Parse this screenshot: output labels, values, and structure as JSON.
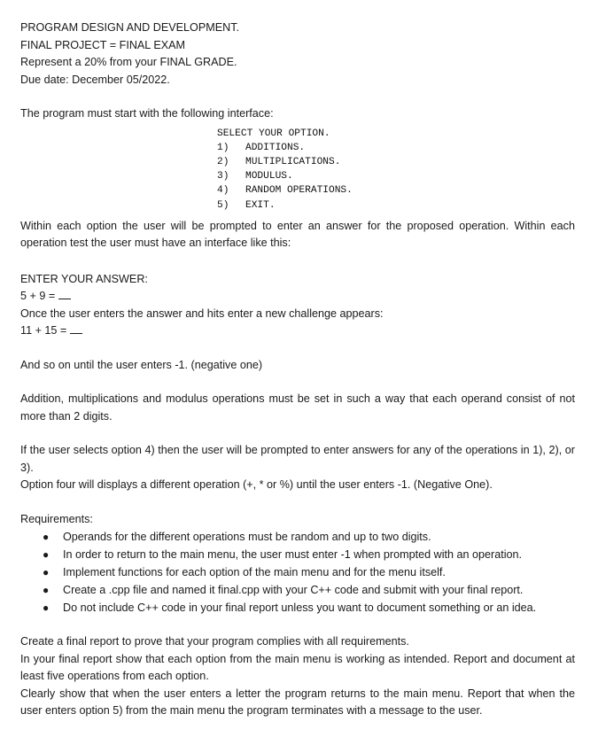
{
  "header": {
    "course": "PROGRAM DESIGN AND DEVELOPMENT.",
    "project": "FINAL PROJECT = FINAL EXAM",
    "weight": "Represent a 20% from your FINAL GRADE.",
    "due": "Due date: December 05/2022."
  },
  "intro": "The program must start with the following interface:",
  "menu": {
    "title": "SELECT YOUR OPTION.",
    "options": [
      {
        "num": "1)",
        "label": "ADDITIONS."
      },
      {
        "num": "2)",
        "label": "MULTIPLICATIONS."
      },
      {
        "num": "3)",
        "label": "MODULUS."
      },
      {
        "num": "4)",
        "label": "RANDOM OPERATIONS."
      },
      {
        "num": "5)",
        "label": "EXIT."
      }
    ]
  },
  "within": "Within each option the user will be prompted to enter an answer for the proposed operation. Within each operation test the user must have an interface like this:",
  "example": {
    "prompt": "ENTER YOUR ANSWER:",
    "first": "5 + 9 =",
    "after_enter": "Once the user enters the answer and hits enter a new challenge appears:",
    "second": "11 + 15 ="
  },
  "until": "And so on until the user enters -1. (negative one)",
  "operands": "Addition, multiplications and modulus operations must be set in such a way that each operand consist of not more than 2 digits.",
  "option4": {
    "line1": "If the user selects option 4) then the user will be prompted to enter answers for any of the operations in 1), 2), or 3).",
    "line2": "Option four will displays a different operation (+, * or %) until the user enters -1. (Negative One)."
  },
  "requirements": {
    "title": "Requirements:",
    "items": [
      "Operands for the different operations must be random and up to two digits.",
      "In order to return to the main menu, the user must enter -1 when prompted with an operation.",
      "Implement functions for each option of the main menu and for the menu itself.",
      "Create a .cpp file and named it final.cpp with your C++ code and submit with your final report.",
      "Do not include C++ code in your final report unless you want to document something or an idea."
    ]
  },
  "report": {
    "line1": "Create a final report to prove that your program complies with all requirements.",
    "line2": "In your final report show that each option from the main menu is working as intended. Report and document at least five operations from each option.",
    "line3": "Clearly show that when the user enters a letter the program returns to the main menu. Report that when the user enters option 5) from the main menu the program terminates with a message to the user."
  }
}
